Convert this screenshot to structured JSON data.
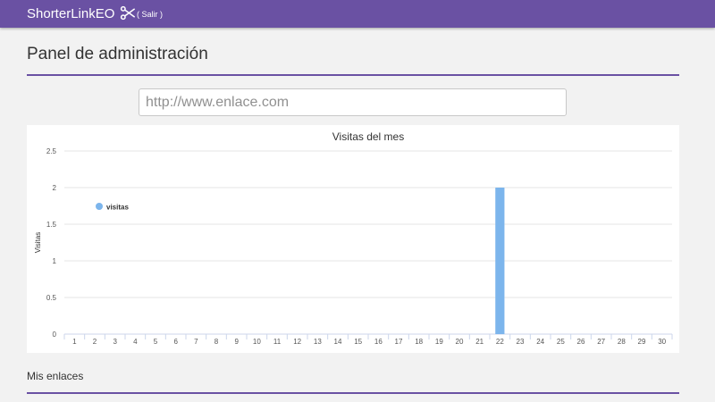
{
  "header": {
    "brand": "ShorterLinkEO",
    "logout_label": "( Salir )",
    "brand_icon": "scissors-icon",
    "bar_color": "#6a51a3"
  },
  "main": {
    "title": "Panel de administración",
    "url_input": {
      "placeholder": "http://www.enlace.com",
      "value": ""
    },
    "links_section_title": "Mis enlaces"
  },
  "chart_data": {
    "type": "bar",
    "title": "Visitas del mes",
    "ylabel": "Visitas",
    "xlabel": "",
    "ylim": [
      0,
      2.5
    ],
    "yticks": [
      "0",
      "0.5",
      "1",
      "1.5",
      "2",
      "2.5"
    ],
    "grid": true,
    "legend_position": "top-left",
    "categories": [
      "1",
      "2",
      "3",
      "4",
      "5",
      "6",
      "7",
      "8",
      "9",
      "10",
      "11",
      "12",
      "13",
      "14",
      "15",
      "16",
      "17",
      "18",
      "19",
      "20",
      "21",
      "22",
      "23",
      "24",
      "25",
      "26",
      "27",
      "28",
      "29",
      "30"
    ],
    "series": [
      {
        "name": "visitas",
        "color": "#7cb5ec",
        "values": [
          0,
          0,
          0,
          0,
          0,
          0,
          0,
          0,
          0,
          0,
          0,
          0,
          0,
          0,
          0,
          0,
          0,
          0,
          0,
          0,
          0,
          2,
          0,
          0,
          0,
          0,
          0,
          0,
          0,
          0
        ]
      }
    ]
  }
}
